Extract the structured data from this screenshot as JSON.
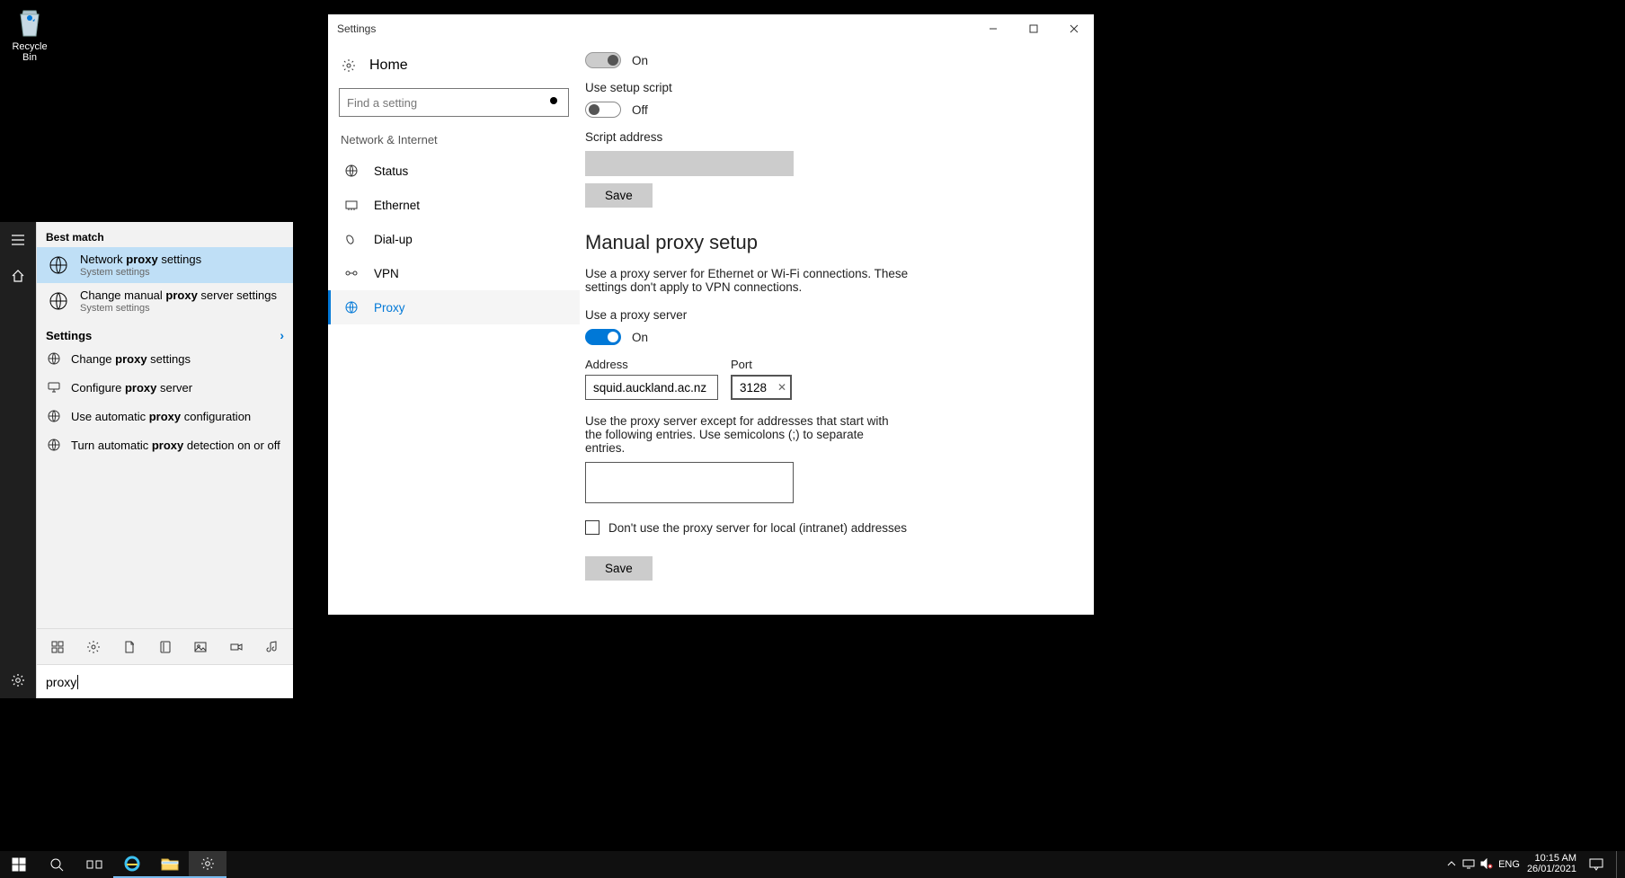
{
  "desktop": {
    "recycle_bin": "Recycle Bin"
  },
  "start_rail": {
    "items": [
      "menu",
      "home",
      "settings"
    ]
  },
  "search": {
    "best_match_hdr": "Best match",
    "results": [
      {
        "title_pre": "Network ",
        "title_bold": "proxy",
        "title_post": " settings",
        "sub": "System settings"
      },
      {
        "title_pre": "Change manual ",
        "title_bold": "proxy",
        "title_post": " server settings",
        "sub": "System settings"
      }
    ],
    "settings_hdr": "Settings",
    "settings_items": [
      {
        "pre": "Change ",
        "bold": "proxy",
        "post": " settings"
      },
      {
        "pre": "Configure ",
        "bold": "proxy",
        "post": " server"
      },
      {
        "pre": "Use automatic ",
        "bold": "proxy",
        "post": " configuration"
      },
      {
        "pre": "Turn automatic ",
        "bold": "proxy",
        "post": " detection on or off"
      }
    ],
    "query": "proxy"
  },
  "settings_win": {
    "title": "Settings",
    "home": "Home",
    "find_placeholder": "Find a setting",
    "category": "Network & Internet",
    "nav": [
      "Status",
      "Ethernet",
      "Dial-up",
      "VPN",
      "Proxy"
    ],
    "content": {
      "auto_toggle_label": "On",
      "setup_script_hdr": "Use setup script",
      "setup_script_state": "Off",
      "script_address_label": "Script address",
      "save1": "Save",
      "manual_hdr": "Manual proxy setup",
      "manual_desc": "Use a proxy server for Ethernet or Wi-Fi connections. These settings don't apply to VPN connections.",
      "use_proxy_label": "Use a proxy server",
      "use_proxy_state": "On",
      "address_label": "Address",
      "address_value": "squid.auckland.ac.nz",
      "port_label": "Port",
      "port_value": "3128",
      "exceptions_text": "Use the proxy server except for addresses that start with the following entries. Use semicolons (;) to separate entries.",
      "local_chk": "Don't use the proxy server for local (intranet) addresses",
      "save2": "Save"
    }
  },
  "taskbar": {
    "systray": {
      "lang": "ENG",
      "time": "10:15 AM",
      "date": "26/01/2021"
    }
  }
}
